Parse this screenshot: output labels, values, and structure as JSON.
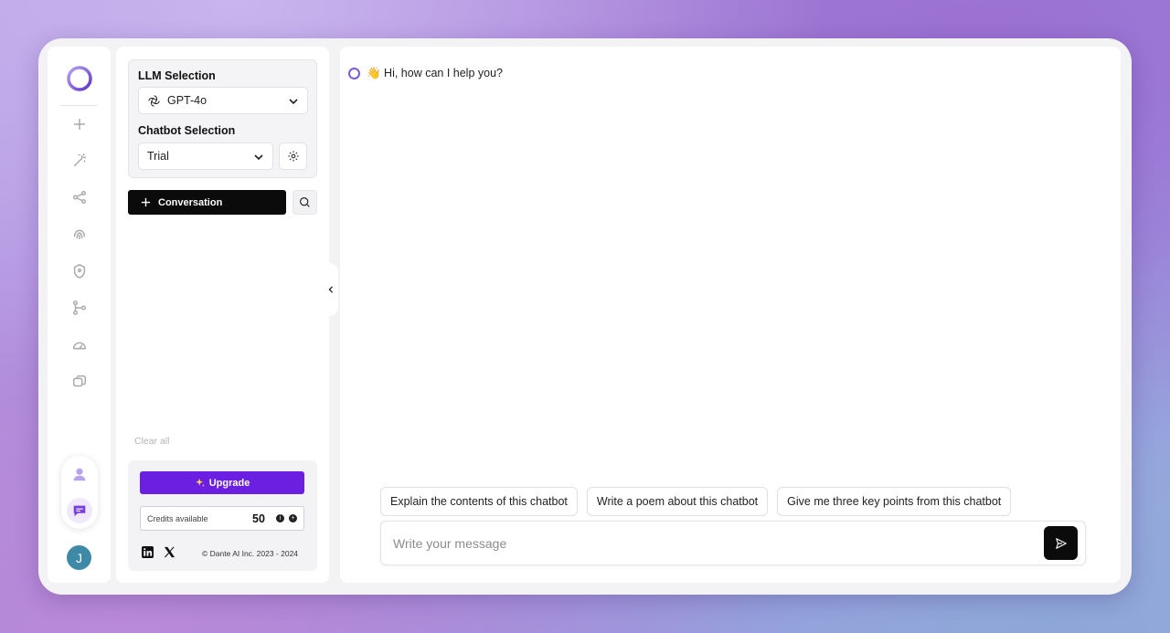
{
  "llm": {
    "label": "LLM Selection",
    "selected": "GPT-4o"
  },
  "chatbot": {
    "label": "Chatbot Selection",
    "selected": "Trial"
  },
  "sidebar": {
    "new_conversation_label": "Conversation",
    "clear_all": "Clear all",
    "upgrade_label": "Upgrade",
    "credits_label": "Credits available",
    "credits_value": "50",
    "copyright": "© Dante AI Inc. 2023 - 2024"
  },
  "user": {
    "avatar_initial": "J"
  },
  "chat": {
    "greeting": "👋 Hi, how can I help you?",
    "suggestions": [
      "Explain the contents of this chatbot",
      "Write a poem about this chatbot",
      "Give me three key points from this chatbot"
    ],
    "input_placeholder": "Write your message"
  },
  "colors": {
    "accent": "#6b1fe0",
    "brand": "#7a5ad6",
    "avatar": "#3e8aa6"
  },
  "icons": {
    "rail": [
      "plus-icon",
      "magic-wand-icon",
      "share-icon",
      "fingerprint-icon",
      "shield-icon",
      "git-branch-icon",
      "gauge-icon",
      "chat-copy-icon"
    ],
    "pill": [
      "user-icon",
      "chat-bubble-icon"
    ]
  }
}
